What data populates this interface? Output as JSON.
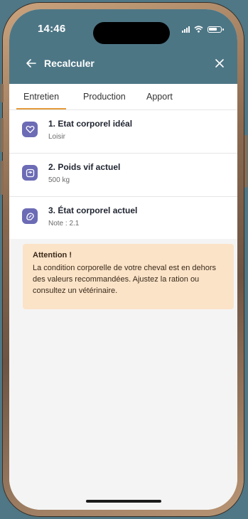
{
  "status_bar": {
    "time": "14:46"
  },
  "nav": {
    "title": "Recalculer"
  },
  "tabs": [
    {
      "label": "Entretien",
      "active": true
    },
    {
      "label": "Production",
      "active": false
    },
    {
      "label": "Apport",
      "active": false
    }
  ],
  "items": [
    {
      "title": "1. Etat corporel idéal",
      "subtitle": "Loisir",
      "icon": "heart-icon"
    },
    {
      "title": "2. Poids vif actuel",
      "subtitle": "500 kg",
      "icon": "scale-icon"
    },
    {
      "title": "3. État corporel actuel",
      "subtitle": "Note : 2.1",
      "icon": "gauge-icon"
    }
  ],
  "alert": {
    "title": "Attention !",
    "text": "La condition corporelle de votre cheval est en dehors des valeurs recommandées. Ajustez la ration ou consultez un vétérinaire."
  },
  "colors": {
    "header": "#4d7685",
    "accent_tab": "#e59b3d",
    "icon_bg": "#6c6bb5",
    "alert_bg": "#fbe3c8"
  }
}
